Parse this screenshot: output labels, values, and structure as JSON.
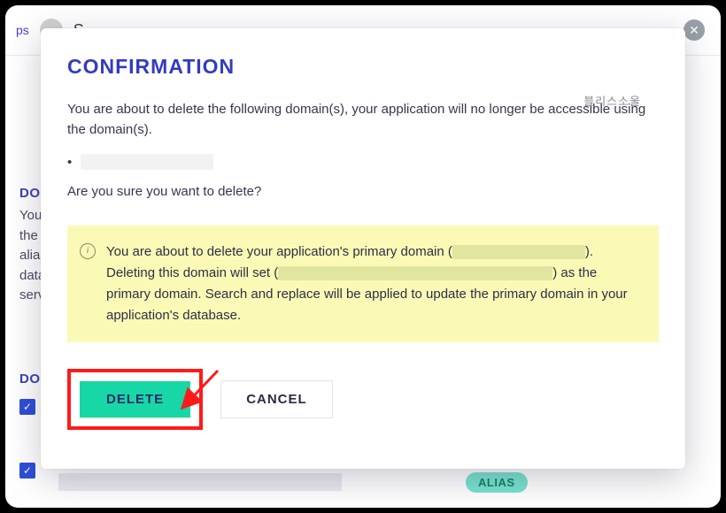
{
  "modal": {
    "title": "CONFIRMATION",
    "intro": "You are about to delete the following domain(s), your application will no longer be accessible using the domain(s).",
    "confirm_question": "Are you sure you want to delete?",
    "notice_before": "You are about to delete your application's primary domain (",
    "notice_mid1": "). Deleting this domain will set (",
    "notice_mid2": ") as the primary domain. Search and replace will be applied to update the primary domain in your application's database.",
    "delete_label": "DELETE",
    "cancel_label": "CANCEL"
  },
  "background": {
    "top_link": "ps",
    "app_letter": "S",
    "heading1": "DOMAIN",
    "paragraph": "You the alias data server",
    "heading2": "DOMAINS",
    "alias_label": "ALIAS"
  },
  "watermark": "블리스소울"
}
